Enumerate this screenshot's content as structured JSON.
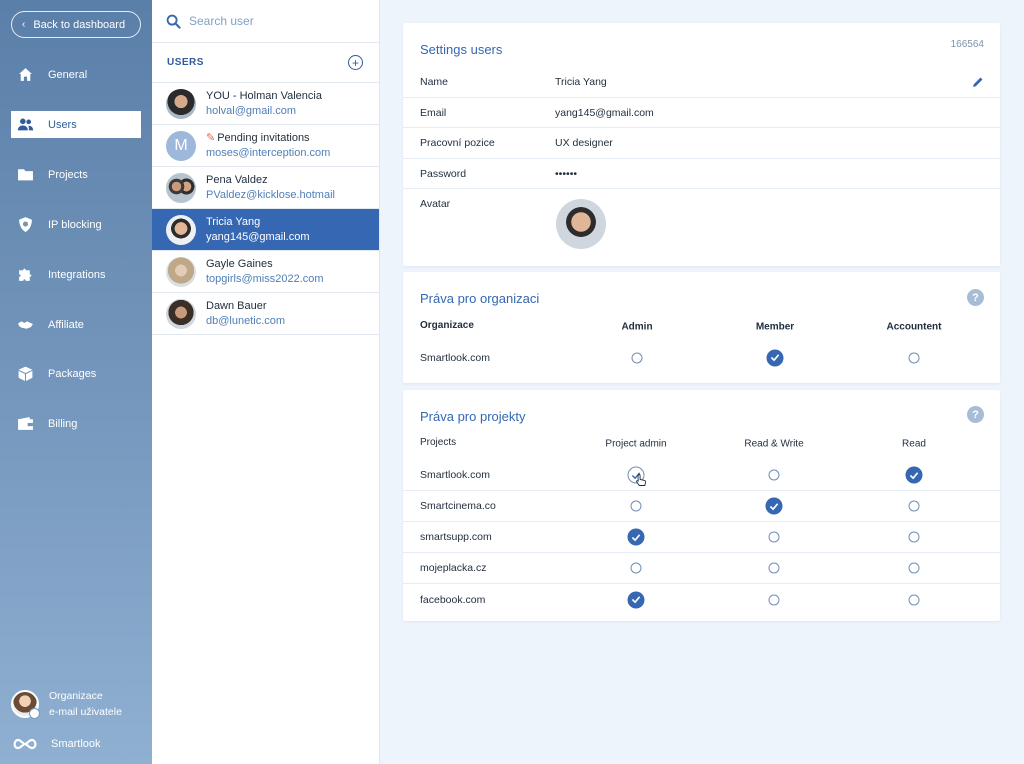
{
  "nav": {
    "back_label": "Back to dashboard",
    "items": [
      {
        "label": "General",
        "icon": "home-icon"
      },
      {
        "label": "Users",
        "icon": "users-icon",
        "active": true
      },
      {
        "label": "Projects",
        "icon": "folder-icon"
      },
      {
        "label": "IP blocking",
        "icon": "shield-icon"
      },
      {
        "label": "Integrations",
        "icon": "puzzle-icon"
      },
      {
        "label": "Affiliate",
        "icon": "handshake-icon"
      },
      {
        "label": "Packages",
        "icon": "box-icon"
      },
      {
        "label": "Billing",
        "icon": "wallet-icon"
      }
    ],
    "org_name": "Organizace",
    "org_email": "e-mail uživatele",
    "brand": "Smartlook"
  },
  "users_panel": {
    "search_placeholder": "Search user",
    "section_label": "USERS",
    "users": [
      {
        "name": "YOU - Holman Valencia",
        "email": "holval@gmail.com"
      },
      {
        "name": "Pending invitations",
        "email": "moses@interception.com",
        "initial": "M"
      },
      {
        "name": "Pena Valdez",
        "email": "PValdez@kicklose.hotmail"
      },
      {
        "name": "Tricia Yang",
        "email": "yang145@gmail.com",
        "selected": true
      },
      {
        "name": "Gayle Gaines",
        "email": "topgirls@miss2022.com"
      },
      {
        "name": "Dawn Bauer",
        "email": "db@lunetic.com"
      }
    ]
  },
  "settings": {
    "title": "Settings users",
    "id": "166564",
    "fields": {
      "name_label": "Name",
      "name_value": "Tricia Yang",
      "email_label": "Email",
      "email_value": "yang145@gmail.com",
      "position_label": "Pracovní pozice",
      "position_value": "UX designer",
      "password_label": "Password",
      "password_value": "••••••",
      "avatar_label": "Avatar"
    }
  },
  "org_rights": {
    "title": "Práva pro organizaci",
    "headers": [
      "Organizace",
      "Admin",
      "Member",
      "Accountent"
    ],
    "rows": [
      {
        "name": "Smartlook.com",
        "selected": 1
      }
    ]
  },
  "project_rights": {
    "title": "Práva pro projekty",
    "headers": [
      "Projects",
      "Project admin",
      "Read & Write",
      "Read"
    ],
    "rows": [
      {
        "name": "Smartlook.com",
        "selected": 2,
        "hover": 0
      },
      {
        "name": "Smartcinema.co",
        "selected": 1
      },
      {
        "name": "smartsupp.com",
        "selected": 0
      },
      {
        "name": "mojeplacka.cz",
        "selected": -1
      },
      {
        "name": "facebook.com",
        "selected": 0
      }
    ]
  },
  "colors": {
    "accent": "#3567b2",
    "nav_top": "#5a7fa8",
    "nav_bottom": "#8fb0d1",
    "page_bg": "#eef4fc"
  }
}
